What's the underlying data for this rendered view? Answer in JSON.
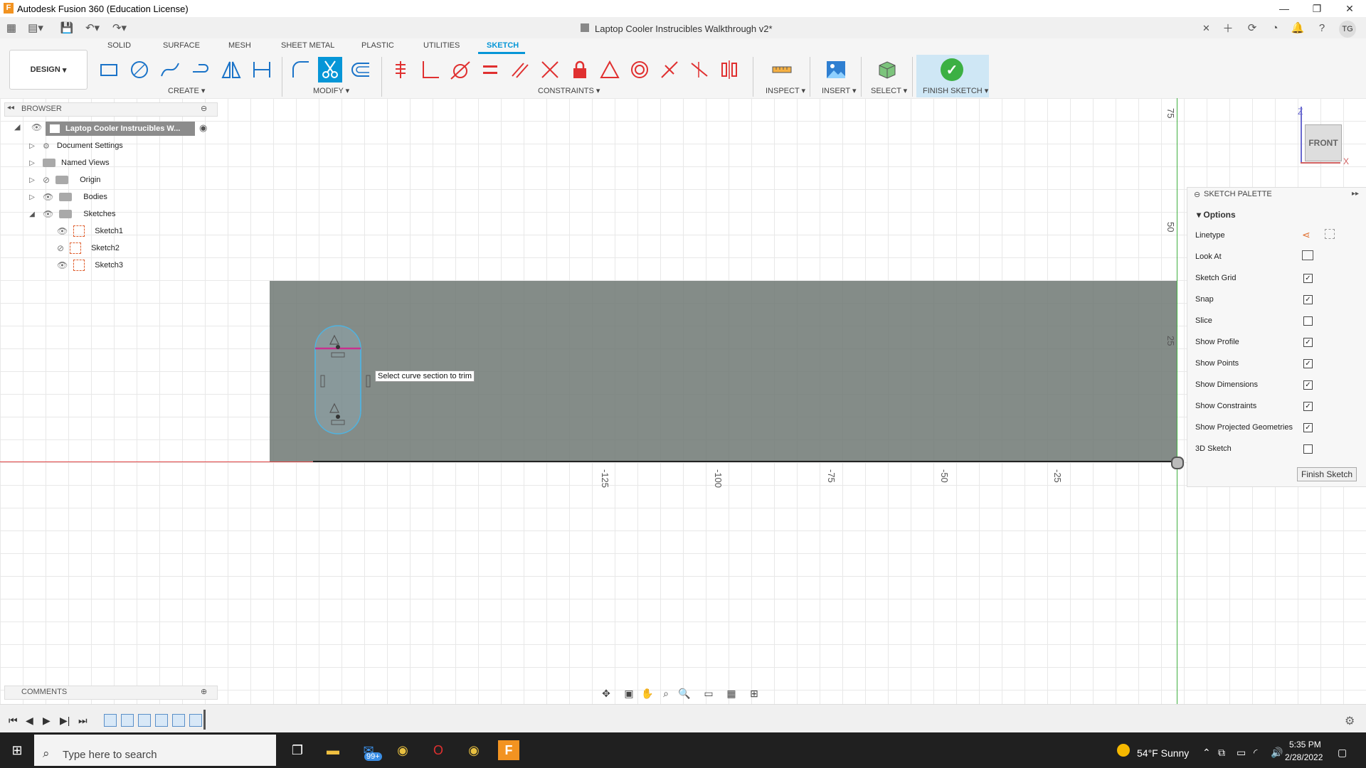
{
  "window": {
    "app_title": "Autodesk Fusion 360 (Education License)",
    "doc_title": "Laptop Cooler Instrucibles Walkthrough v2*",
    "user_initials": "TG"
  },
  "toolbar": {
    "design_label": "DESIGN",
    "tabs": [
      "SOLID",
      "SURFACE",
      "MESH",
      "SHEET METAL",
      "PLASTIC",
      "UTILITIES",
      "SKETCH"
    ],
    "groups": {
      "create": "CREATE",
      "modify": "MODIFY",
      "constraints": "CONSTRAINTS",
      "inspect": "INSPECT",
      "insert": "INSERT",
      "select": "SELECT",
      "finish_sketch": "FINISH SKETCH"
    }
  },
  "browser": {
    "title": "BROWSER",
    "root": "Laptop Cooler Instrucibles W...",
    "items": [
      {
        "label": "Document Settings"
      },
      {
        "label": "Named Views"
      },
      {
        "label": "Origin"
      },
      {
        "label": "Bodies"
      },
      {
        "label": "Sketches"
      },
      {
        "label": "Sketch1"
      },
      {
        "label": "Sketch2"
      },
      {
        "label": "Sketch3"
      }
    ]
  },
  "canvas": {
    "tooltip": "Select curve section to trim",
    "x_ticks": [
      "-125",
      "-100",
      "-75",
      "-50",
      "-25"
    ],
    "y_ticks": [
      "75",
      "50",
      "25"
    ],
    "view_cube": "FRONT",
    "axis_z": "Z",
    "axis_x": "X"
  },
  "palette": {
    "title": "SKETCH PALETTE",
    "options_title": "Options",
    "rows": [
      {
        "label": "Linetype"
      },
      {
        "label": "Look At"
      },
      {
        "label": "Sketch Grid",
        "checked": "✓"
      },
      {
        "label": "Snap",
        "checked": "✓"
      },
      {
        "label": "Slice",
        "checked": ""
      },
      {
        "label": "Show Profile",
        "checked": "✓"
      },
      {
        "label": "Show Points",
        "checked": "✓"
      },
      {
        "label": "Show Dimensions",
        "checked": "✓"
      },
      {
        "label": "Show Constraints",
        "checked": "✓"
      },
      {
        "label": "Show Projected Geometries",
        "checked": "✓"
      },
      {
        "label": "3D Sketch",
        "checked": ""
      }
    ],
    "finish_button": "Finish Sketch"
  },
  "comments": {
    "label": "COMMENTS"
  },
  "taskbar": {
    "search_placeholder": "Type here to search",
    "mail_badge": "99+",
    "weather": "54°F  Sunny",
    "time": "5:35 PM",
    "date": "2/28/2022"
  },
  "colors": {
    "accent": "#0696d7",
    "finish_green": "#3cb043",
    "constraint_red": "#e03030",
    "x_axis": "#e04040",
    "y_axis": "#40b040"
  }
}
